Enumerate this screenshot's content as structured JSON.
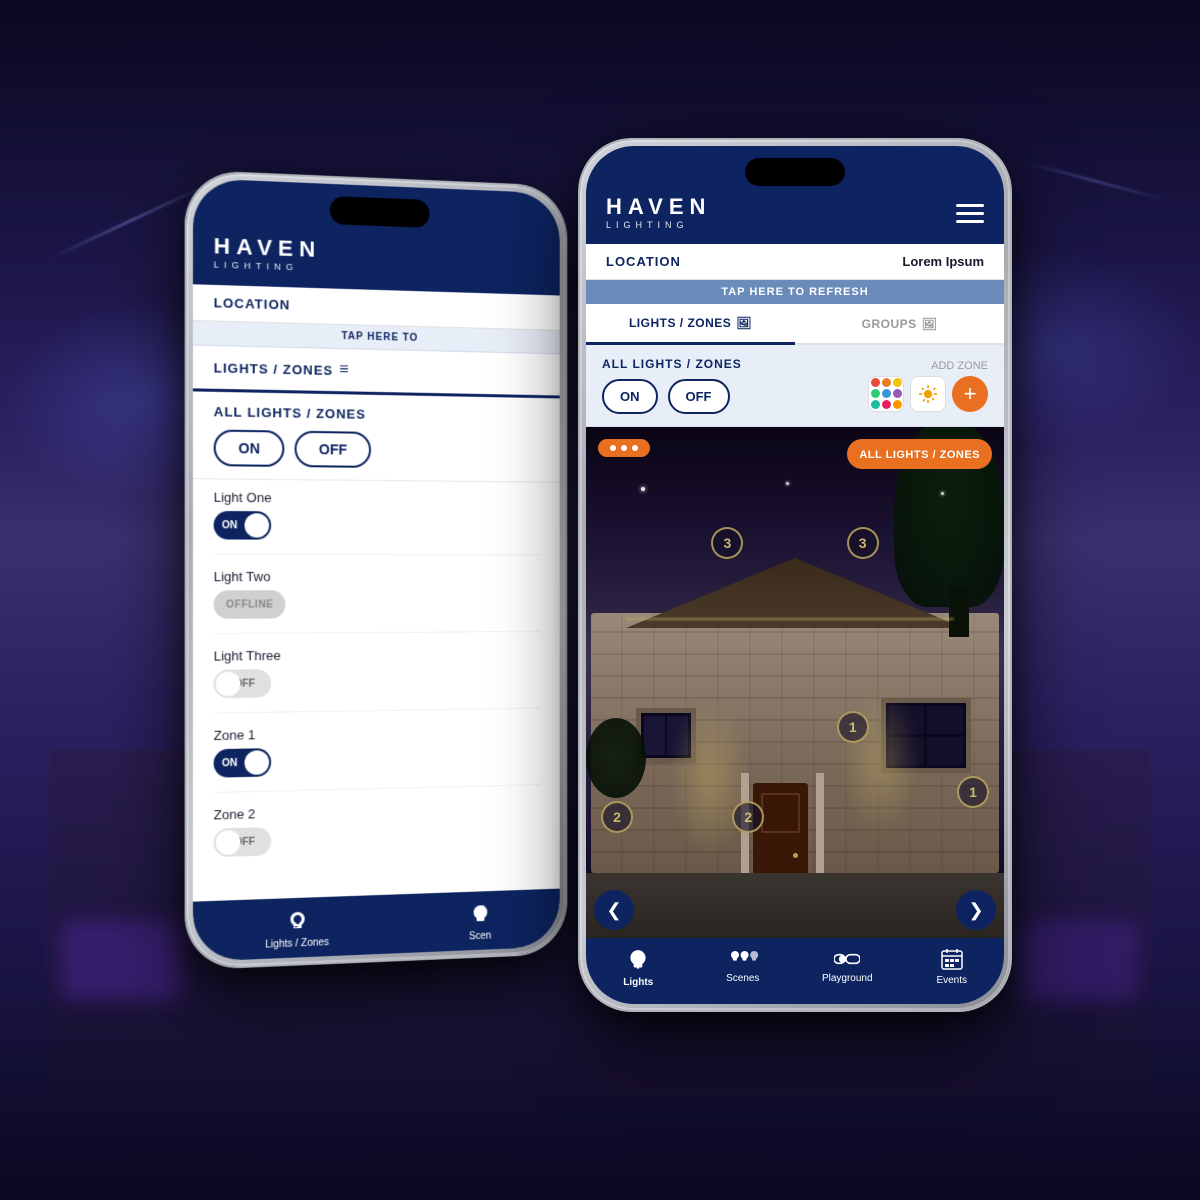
{
  "app": {
    "name": "Haven Lighting",
    "logo": {
      "haven": "HAVEN",
      "lighting": "LIGHTING"
    }
  },
  "back_phone": {
    "location": {
      "label": "LOCATION"
    },
    "refresh_bar": "TAP HERE TO",
    "tabs": {
      "active": "LIGHTS / ZONES",
      "active_icon": "≡"
    },
    "all_lights": {
      "title": "ALL LIGHTS / ZONES",
      "on_label": "ON",
      "off_label": "OFF"
    },
    "lights": [
      {
        "name": "Light One",
        "state": "on",
        "label": "ON"
      },
      {
        "name": "Light Two",
        "state": "offline",
        "label": "OFFLINE"
      },
      {
        "name": "Light Three",
        "state": "off",
        "label": "OFF"
      },
      {
        "name": "Zone 1",
        "state": "on",
        "label": "ON"
      },
      {
        "name": "Zone 2",
        "state": "off",
        "label": "OFF"
      }
    ],
    "bottom_nav": [
      {
        "label": "Lights / Zones",
        "icon": "bulb"
      },
      {
        "label": "Scen",
        "icon": "scene"
      }
    ]
  },
  "front_phone": {
    "location": {
      "label": "LOCATION",
      "value": "Lorem Ipsum"
    },
    "refresh_bar": "TAP HERE TO REFRESH",
    "tabs": [
      {
        "label": "LIGHTS / ZONES",
        "active": true,
        "icon": "🖼"
      },
      {
        "label": "GROUPS",
        "active": false,
        "icon": "🖼"
      }
    ],
    "all_lights": {
      "title": "ALL LIGHTS / ZONES",
      "add_zone": "ADD ZONE",
      "on_label": "ON",
      "off_label": "OFF"
    },
    "photo_overlay": {
      "dots_btn": "...",
      "zone_btn": "ALL LIGHTS / ZONES"
    },
    "zone_markers": [
      {
        "value": "3",
        "pos": "top-left"
      },
      {
        "value": "3",
        "pos": "top-right"
      },
      {
        "value": "2",
        "pos": "mid-left"
      },
      {
        "value": "2",
        "pos": "mid-center-left"
      },
      {
        "value": "1",
        "pos": "mid-center-right"
      },
      {
        "value": "1",
        "pos": "right"
      }
    ],
    "nav_left": "❮",
    "nav_right": "❯",
    "bottom_nav": [
      {
        "label": "Lights",
        "active": true,
        "icon": "bulb-single"
      },
      {
        "label": "Scenes",
        "active": false,
        "icon": "bulb-triple"
      },
      {
        "label": "Playground",
        "active": false,
        "icon": "toggle"
      },
      {
        "label": "Events",
        "active": false,
        "icon": "calendar"
      }
    ]
  },
  "colors": {
    "navy": "#0d2461",
    "orange": "#e87020",
    "light_bg": "#f0f4f8",
    "color_dots": [
      "#e74c3c",
      "#e67e22",
      "#f1c40f",
      "#2ecc71",
      "#3498db",
      "#9b59b6",
      "#1abc9c",
      "#e91e63",
      "#ff9800"
    ]
  }
}
